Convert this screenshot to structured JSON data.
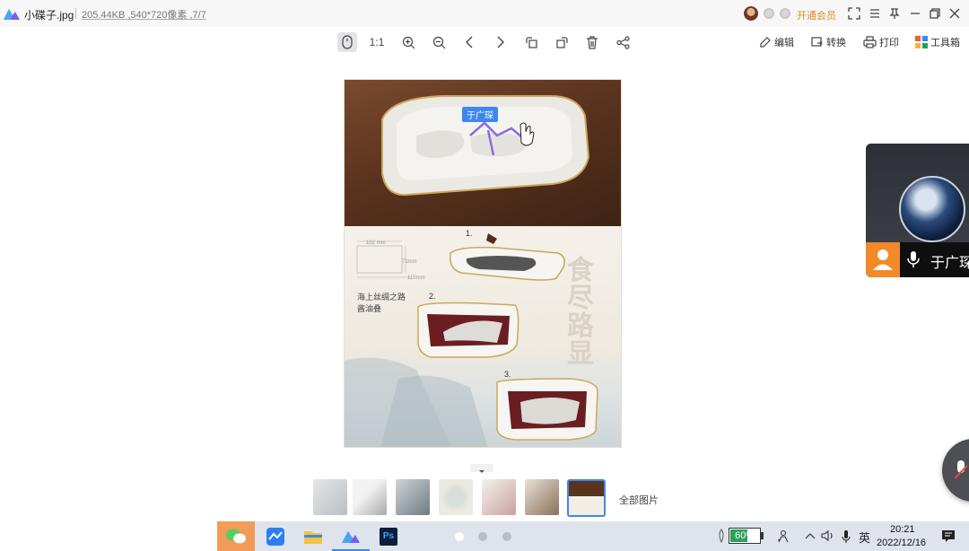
{
  "titlebar": {
    "file_name": "小碟子.jpg",
    "file_meta": "205.44KB ,540*720像素 ,7/7",
    "vip_link": "开通会员"
  },
  "toolbar": {
    "actual_size": "1:1",
    "edit": "编辑",
    "convert": "转换",
    "print": "打印",
    "toolbox": "工具箱"
  },
  "image": {
    "tooltip_tag": "于广琛",
    "dimension_top": "102 mm",
    "dimension_side": "71mm",
    "dimension_bottom": "115mm",
    "caption_line1": "海上丝绸之路",
    "caption_line2": "酱油叠",
    "step1": "1.",
    "step2": "2.",
    "step3": "3.",
    "vertical_title": "食尽路显"
  },
  "thumbnails": {
    "count": 7,
    "selected_index": 6,
    "all_images_label": "全部图片"
  },
  "video_call": {
    "participant_name": "于广琛"
  },
  "taskbar": {
    "apps": [
      "wechat-icon",
      "feishu-icon",
      "file-explorer-icon",
      "image-viewer-icon",
      "photoshop-icon"
    ],
    "photoshop_label": "Ps",
    "battery_percent": "60%",
    "battery_level": 0.6,
    "ime_label": "英",
    "time": "20:21",
    "date": "2022/12/16"
  },
  "colors": {
    "accent_blue": "#3d87f2",
    "vip_orange": "#e08a1e",
    "battery_green": "#2aa05a",
    "user_tile_orange": "#f28a2a"
  }
}
